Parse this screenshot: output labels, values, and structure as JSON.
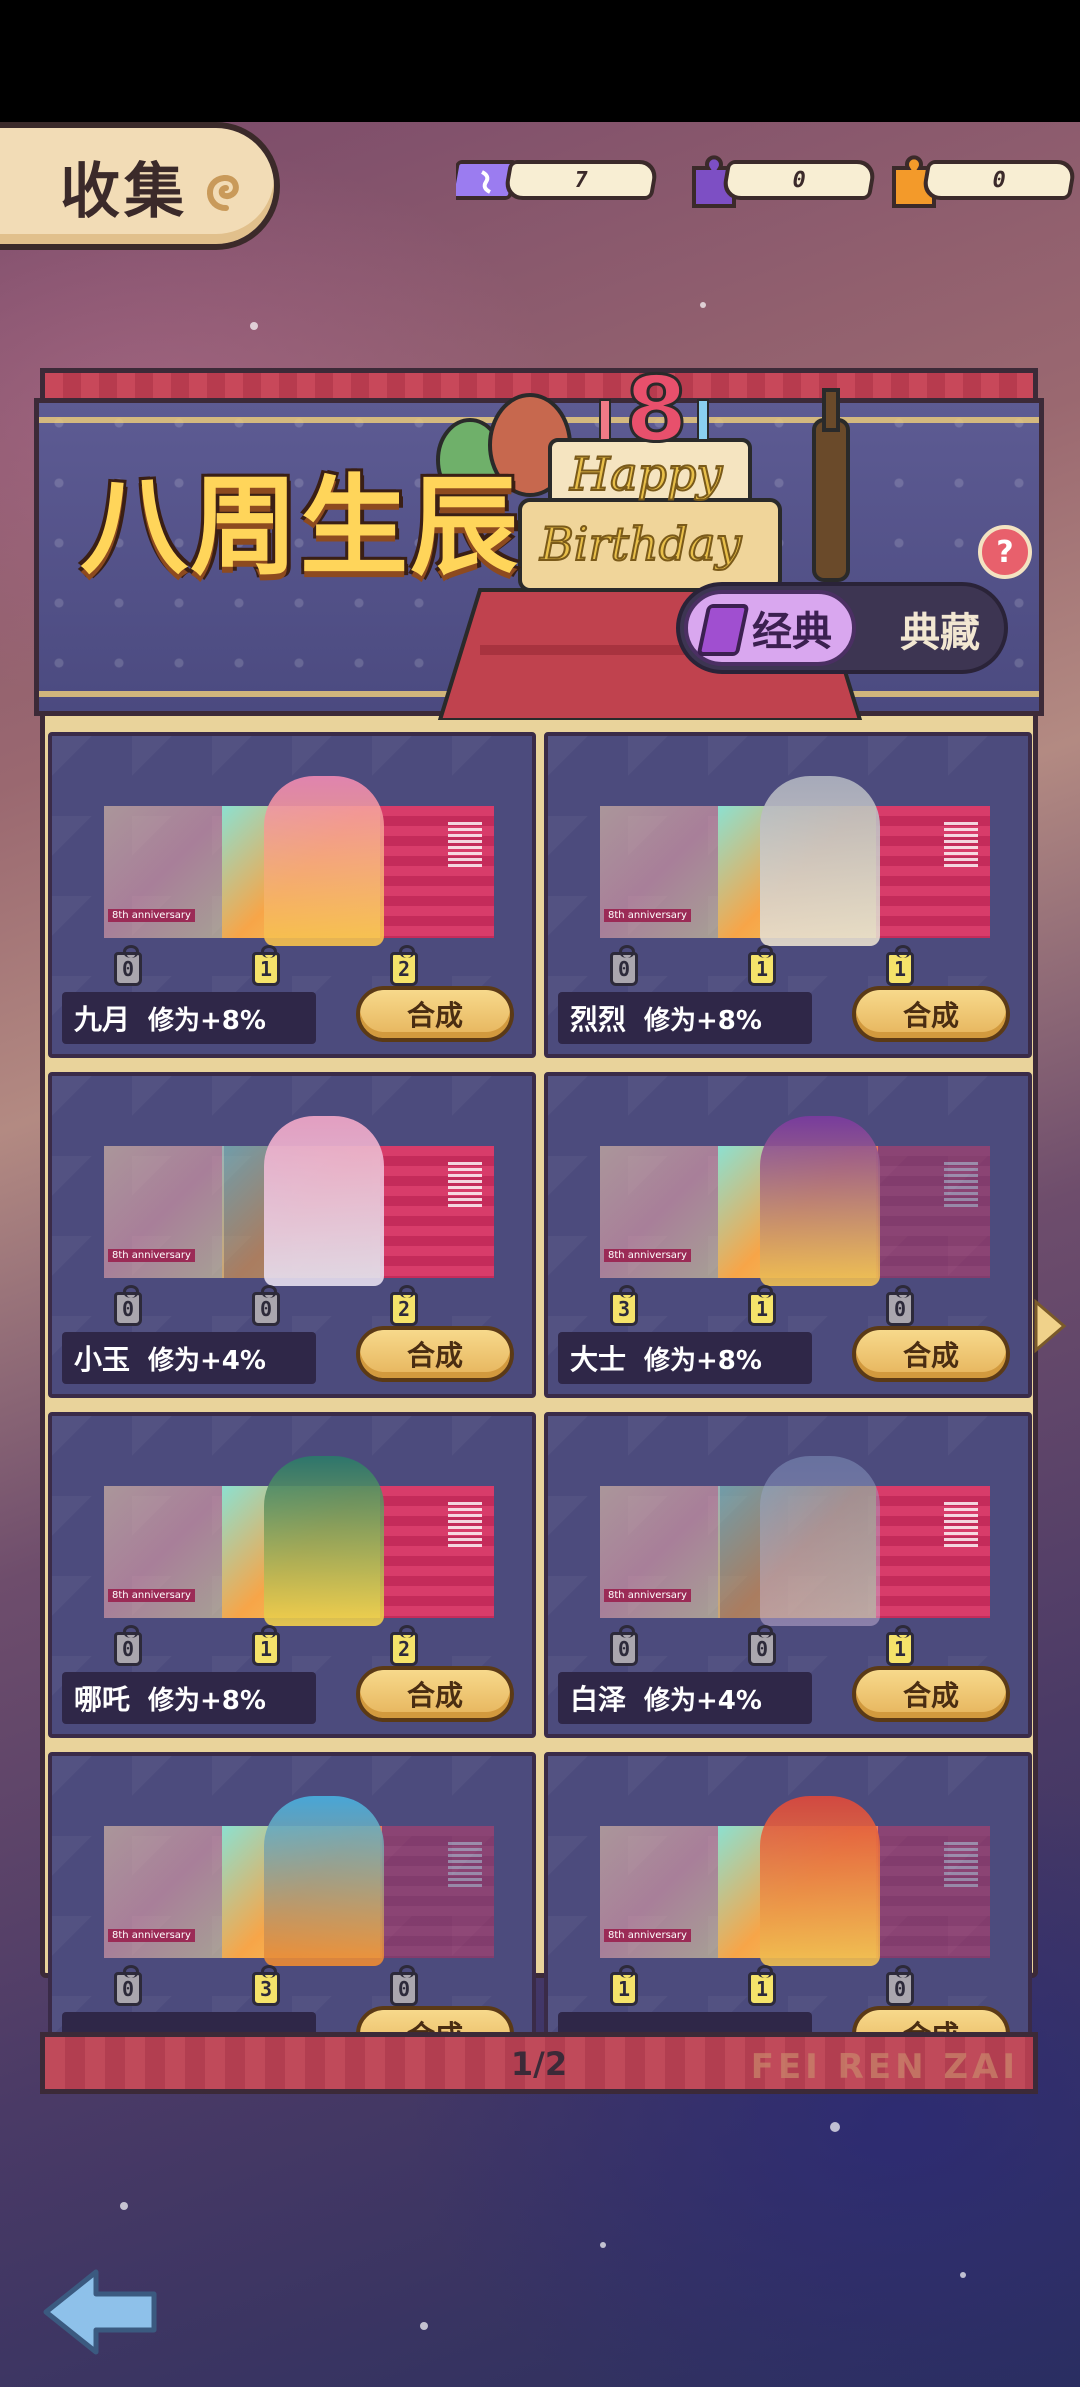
{
  "screen": {
    "title": "收集",
    "currencies": [
      {
        "icon": "ticket-icon",
        "value": "7",
        "color": "#8c6fe0"
      },
      {
        "icon": "purple-puzzle-icon",
        "value": "0",
        "color": "#7d4fc4"
      },
      {
        "icon": "orange-puzzle-icon",
        "value": "0",
        "color": "#f39a2a"
      }
    ]
  },
  "event": {
    "title": "八周生辰",
    "toggle": {
      "active": "经典",
      "inactive": "典藏"
    },
    "help": "?"
  },
  "anniversary_label": "8th anniversary",
  "synth_label": "合成",
  "cards": [
    {
      "name": "九月",
      "bonus": "修为+8%",
      "counts": [
        "0",
        "1",
        "2"
      ]
    },
    {
      "name": "烈烈",
      "bonus": "修为+8%",
      "counts": [
        "0",
        "1",
        "1"
      ]
    },
    {
      "name": "小玉",
      "bonus": "修为+4%",
      "counts": [
        "0",
        "0",
        "2"
      ]
    },
    {
      "name": "大士",
      "bonus": "修为+8%",
      "counts": [
        "3",
        "1",
        "0"
      ]
    },
    {
      "name": "哪吒",
      "bonus": "修为+8%",
      "counts": [
        "0",
        "1",
        "2"
      ]
    },
    {
      "name": "白泽",
      "bonus": "修为+4%",
      "counts": [
        "0",
        "0",
        "1"
      ]
    },
    {
      "name": "",
      "bonus": "",
      "counts": [
        "0",
        "3",
        "0"
      ]
    },
    {
      "name": "",
      "bonus": "",
      "counts": [
        "1",
        "1",
        "0"
      ]
    }
  ],
  "pagination": "1/2",
  "watermark": "FEI REN ZAI"
}
